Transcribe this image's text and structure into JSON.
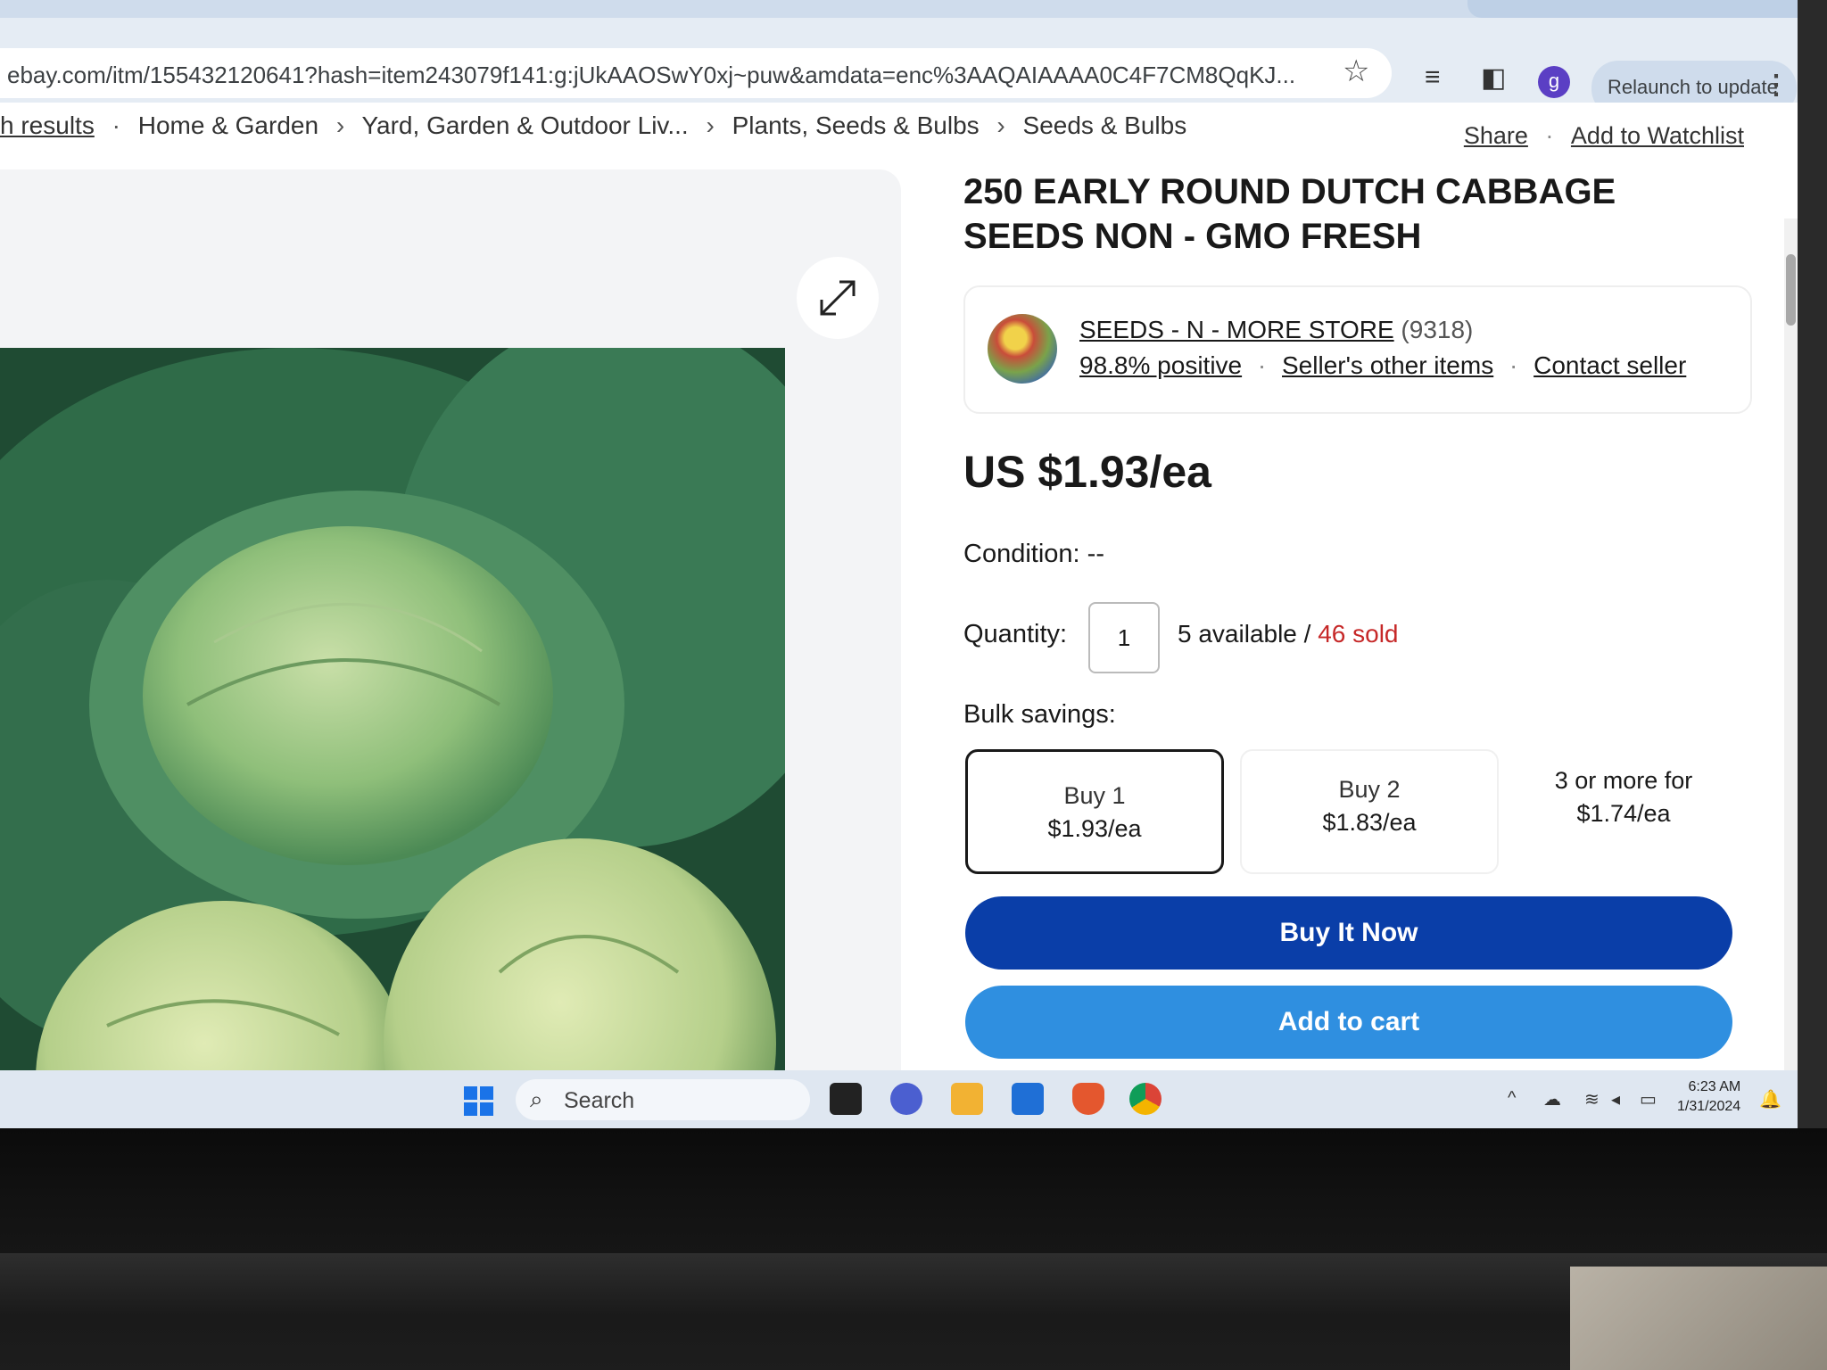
{
  "browser": {
    "url": "ebay.com/itm/155432120641?hash=item243079f141:g:jUkAAOSwY0xj~puw&amdata=enc%3AAQAIAAAA0C4F7CM8QqKJ...",
    "profile_initial": "g",
    "relaunch_label": "Relaunch to update",
    "icons": [
      "star-icon",
      "reading-list-icon",
      "side-panel-icon",
      "kebab-menu-icon"
    ]
  },
  "breadcrumb": {
    "items": [
      "h results",
      "Home & Garden",
      "Yard, Garden & Outdoor Liv...",
      "Plants, Seeds & Bulbs",
      "Seeds & Bulbs"
    ]
  },
  "actions": {
    "share": "Share",
    "watchlist": "Add to Watchlist"
  },
  "listing": {
    "title": "250 EARLY ROUND DUTCH CABBAGE SEEDS NON - GMO FRESH",
    "image_alt": "cabbage heads",
    "price": "US $1.93/ea",
    "condition_label": "Condition:",
    "condition_value": "--",
    "quantity_label": "Quantity:",
    "quantity_value": "1",
    "available": "5 available",
    "sold_sep": " / ",
    "sold": "46 sold",
    "bulk_label": "Bulk savings:",
    "tiers": [
      {
        "label": "Buy 1",
        "price": "$1.93/ea"
      },
      {
        "label": "Buy 2",
        "price": "$1.83/ea"
      },
      {
        "label": "3 or more for",
        "price": "$1.74/ea"
      }
    ],
    "buy_now": "Buy It Now",
    "add_to_cart": "Add to cart"
  },
  "seller": {
    "name": "SEEDS - N - MORE STORE",
    "count": "(9318)",
    "positive": "98.8% positive",
    "other_items": "Seller's other items",
    "contact": "Contact seller"
  },
  "taskbar": {
    "search_label": "Search",
    "time": "6:23 AM",
    "date": "1/31/2024"
  }
}
